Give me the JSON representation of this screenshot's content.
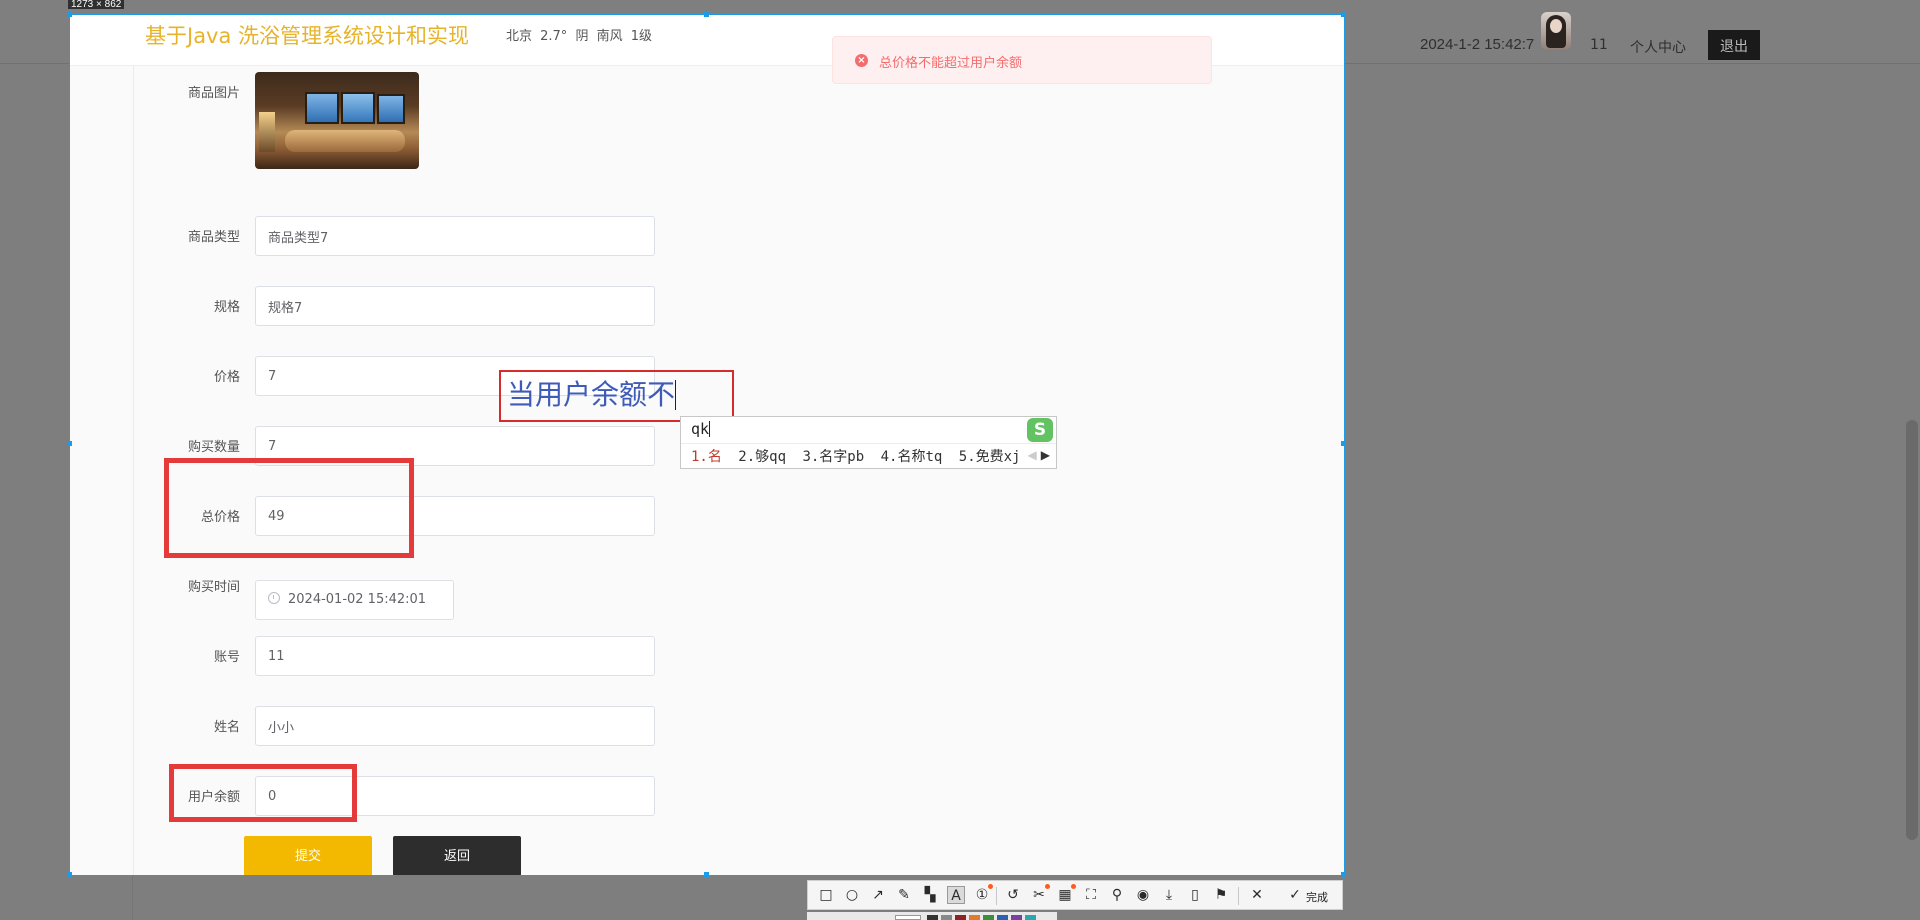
{
  "background_header": {
    "datetime": "2024-1-2 15:42:7",
    "username": "11",
    "personal_center": "个人中心",
    "logout": "退出"
  },
  "capture": {
    "size_label": "1273 × 862"
  },
  "app": {
    "title": "基于Java 洗浴管理系统设计和实现",
    "weather": "北京  2.7°  阴  南风  1级"
  },
  "toast": {
    "icon": "error-circle-icon",
    "message": "总价格不能超过用户余额",
    "color": "#f56c6c"
  },
  "form": {
    "product_image_label": "商品图片",
    "product_type_label": "商品类型",
    "product_type_value": "商品类型7",
    "spec_label": "规格",
    "spec_value": "规格7",
    "price_label": "价格",
    "price_value": "7",
    "quantity_label": "购买数量",
    "quantity_value": "7",
    "total_label": "总价格",
    "total_value": "49",
    "time_label": "购买时间",
    "time_value": "2024-01-02 15:42:01",
    "account_label": "账号",
    "account_value": "11",
    "name_label": "姓名",
    "name_value": "小小",
    "balance_label": "用户余额",
    "balance_value": "0",
    "submit_label": "提交",
    "back_label": "返回"
  },
  "annotation": {
    "text": "当用户余额不",
    "color": "#e43a3a",
    "text_color": "#3f5bb8"
  },
  "ime": {
    "input": "qk",
    "logo": "S",
    "candidates": [
      "1.名",
      "2.够qq",
      "3.名字pb",
      "4.名称tq",
      "5.免费xj"
    ]
  },
  "toolbar": {
    "done_label": "完成",
    "tools": [
      "rectangle-icon",
      "ellipse-icon",
      "arrow-icon",
      "pen-icon",
      "mosaic-icon",
      "text-icon",
      "number-icon",
      "undo-icon",
      "scissors-icon",
      "ocr-icon",
      "scan-icon",
      "pin-icon",
      "record-icon",
      "download-icon",
      "phone-icon",
      "bookmark-icon",
      "close-icon",
      "check-icon"
    ]
  },
  "colors": {
    "accent": "#f3b901",
    "title": "#e7b32a",
    "frame": "#1e9be6",
    "danger": "#f56c6c"
  }
}
